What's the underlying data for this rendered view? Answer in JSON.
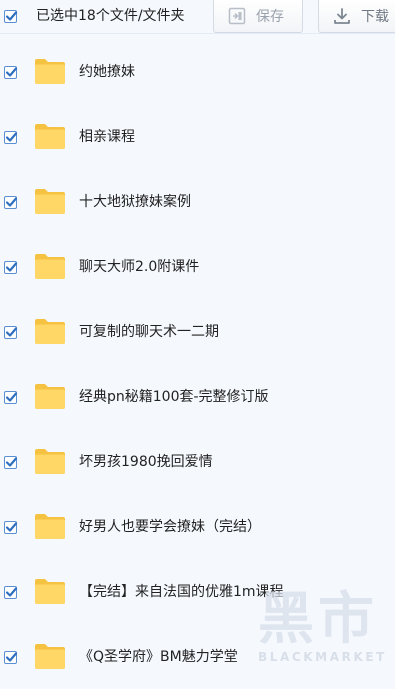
{
  "toolbar": {
    "selection_label": "已选中18个文件/文件夹",
    "save_label": "保存",
    "download_label": "下载",
    "save_icon": "save-icon",
    "download_icon": "download-icon"
  },
  "colors": {
    "background": "#f5f9fe",
    "checkbox_border": "#5a8fd0",
    "checkmark": "#2f6fc0",
    "folder": "#ffd766",
    "folder_dark": "#f5c242"
  },
  "files": [
    {
      "name": "约她撩妹",
      "type": "folder",
      "checked": true
    },
    {
      "name": "相亲课程",
      "type": "folder",
      "checked": true
    },
    {
      "name": "十大地狱撩妹案例",
      "type": "folder",
      "checked": true
    },
    {
      "name": "聊天大师2.0附课件",
      "type": "folder",
      "checked": true
    },
    {
      "name": "可复制的聊天术一二期",
      "type": "folder",
      "checked": true
    },
    {
      "name": "经典pn秘籍100套-完整修订版",
      "type": "folder",
      "checked": true
    },
    {
      "name": "坏男孩1980挽回爱情",
      "type": "folder",
      "checked": true
    },
    {
      "name": "好男人也要学会撩妹（完结）",
      "type": "folder",
      "checked": true
    },
    {
      "name": "【完结】来自法国的优雅1m课程",
      "type": "folder",
      "checked": true
    },
    {
      "name": "《Q圣学府》BM魅力学堂",
      "type": "folder",
      "checked": true
    }
  ],
  "watermark": {
    "glyphs": "黑市",
    "text": "BLACKMARKET"
  }
}
